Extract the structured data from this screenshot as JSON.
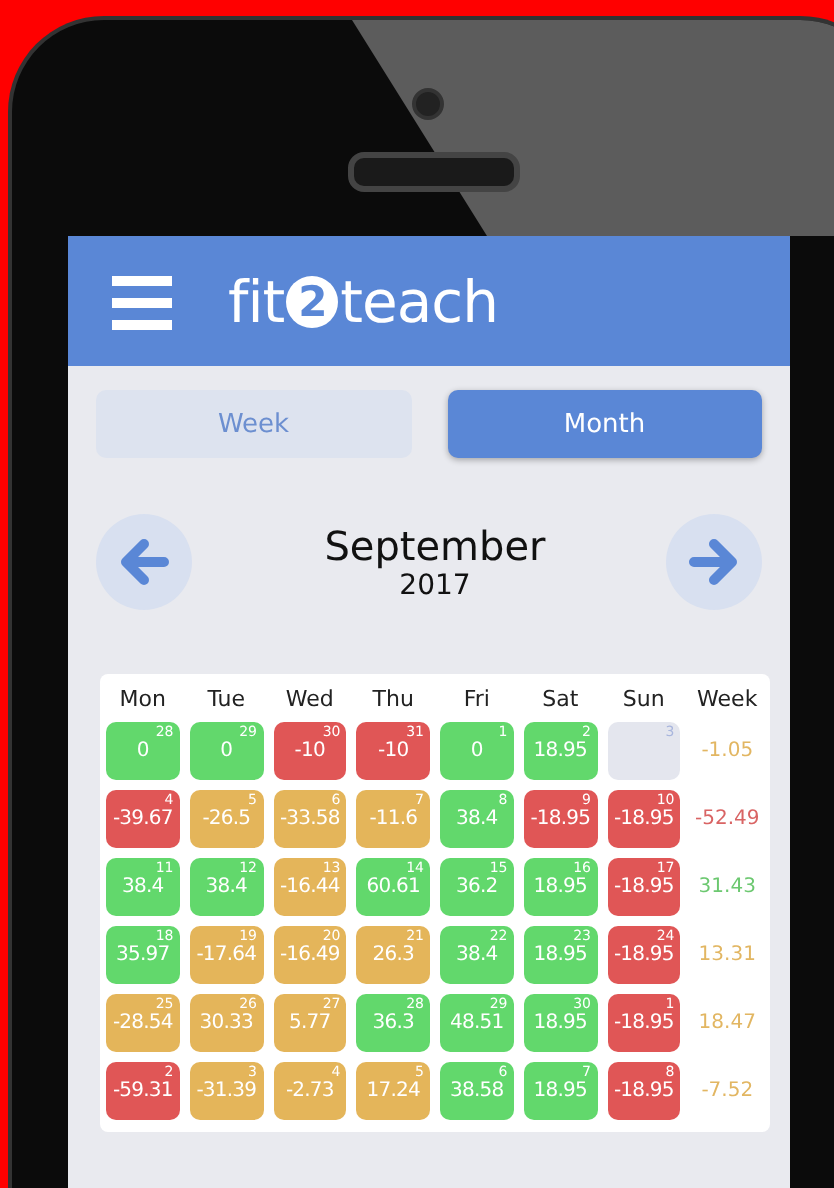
{
  "logo": {
    "before": "fit",
    "mark": "2",
    "after": "teach"
  },
  "tabs": [
    {
      "label": "Week",
      "selected": false
    },
    {
      "label": "Month",
      "selected": true
    }
  ],
  "month": "September",
  "year": "2017",
  "columns": [
    "Mon",
    "Tue",
    "Wed",
    "Thu",
    "Fri",
    "Sat",
    "Sun",
    "Week"
  ],
  "rows": [
    {
      "cells": [
        {
          "value": "0",
          "day": "28",
          "color": "#62d86c"
        },
        {
          "value": "0",
          "day": "29",
          "color": "#62d86c"
        },
        {
          "value": "-10",
          "day": "30",
          "color": "#e05656"
        },
        {
          "value": "-10",
          "day": "31",
          "color": "#e05656"
        },
        {
          "value": "0",
          "day": "1",
          "color": "#62d86c"
        },
        {
          "value": "18.95",
          "day": "2",
          "color": "#62d86c"
        },
        {
          "day": "3",
          "color": "#e4e6ee"
        }
      ],
      "total": {
        "value": "-1.05",
        "color": "#e2b662"
      }
    },
    {
      "cells": [
        {
          "value": "-39.67",
          "day": "4",
          "color": "#e05656"
        },
        {
          "value": "-26.5",
          "day": "5",
          "color": "#e4b55a"
        },
        {
          "value": "-33.58",
          "day": "6",
          "color": "#e4b55a"
        },
        {
          "value": "-11.6",
          "day": "7",
          "color": "#e4b55a"
        },
        {
          "value": "38.4",
          "day": "8",
          "color": "#62d86c"
        },
        {
          "value": "-18.95",
          "day": "9",
          "color": "#e05656"
        },
        {
          "value": "-18.95",
          "day": "10",
          "color": "#e05656"
        }
      ],
      "total": {
        "value": "-52.49",
        "color": "#d96464"
      }
    },
    {
      "cells": [
        {
          "value": "38.4",
          "day": "11",
          "color": "#62d86c"
        },
        {
          "value": "38.4",
          "day": "12",
          "color": "#62d86c"
        },
        {
          "value": "-16.44",
          "day": "13",
          "color": "#e4b55a"
        },
        {
          "value": "60.61",
          "day": "14",
          "color": "#62d86c"
        },
        {
          "value": "36.2",
          "day": "15",
          "color": "#62d86c"
        },
        {
          "value": "18.95",
          "day": "16",
          "color": "#62d86c"
        },
        {
          "value": "-18.95",
          "day": "17",
          "color": "#e05656"
        }
      ],
      "total": {
        "value": "31.43",
        "color": "#6cc870"
      }
    },
    {
      "cells": [
        {
          "value": "35.97",
          "day": "18",
          "color": "#62d86c"
        },
        {
          "value": "-17.64",
          "day": "19",
          "color": "#e4b55a"
        },
        {
          "value": "-16.49",
          "day": "20",
          "color": "#e4b55a"
        },
        {
          "value": "26.3",
          "day": "21",
          "color": "#e4b55a"
        },
        {
          "value": "38.4",
          "day": "22",
          "color": "#62d86c"
        },
        {
          "value": "18.95",
          "day": "23",
          "color": "#62d86c"
        },
        {
          "value": "-18.95",
          "day": "24",
          "color": "#e05656"
        }
      ],
      "total": {
        "value": "13.31",
        "color": "#e2b662"
      }
    },
    {
      "cells": [
        {
          "value": "-28.54",
          "day": "25",
          "color": "#e4b55a"
        },
        {
          "value": "30.33",
          "day": "26",
          "color": "#e4b55a"
        },
        {
          "value": "5.77",
          "day": "27",
          "color": "#e4b55a"
        },
        {
          "value": "36.3",
          "day": "28",
          "color": "#62d86c"
        },
        {
          "value": "48.51",
          "day": "29",
          "color": "#62d86c"
        },
        {
          "value": "18.95",
          "day": "30",
          "color": "#62d86c"
        },
        {
          "value": "-18.95",
          "day": "1",
          "color": "#e05656"
        }
      ],
      "total": {
        "value": "18.47",
        "color": "#e2b662"
      }
    },
    {
      "cells": [
        {
          "value": "-59.31",
          "day": "2",
          "color": "#e05656"
        },
        {
          "value": "-31.39",
          "day": "3",
          "color": "#e4b55a"
        },
        {
          "value": "-2.73",
          "day": "4",
          "color": "#e4b55a"
        },
        {
          "value": "17.24",
          "day": "5",
          "color": "#e4b55a"
        },
        {
          "value": "38.58",
          "day": "6",
          "color": "#62d86c"
        },
        {
          "value": "18.95",
          "day": "7",
          "color": "#62d86c"
        },
        {
          "value": "-18.95",
          "day": "8",
          "color": "#e05656"
        }
      ],
      "total": {
        "value": "-7.52",
        "color": "#e2b662"
      }
    }
  ]
}
